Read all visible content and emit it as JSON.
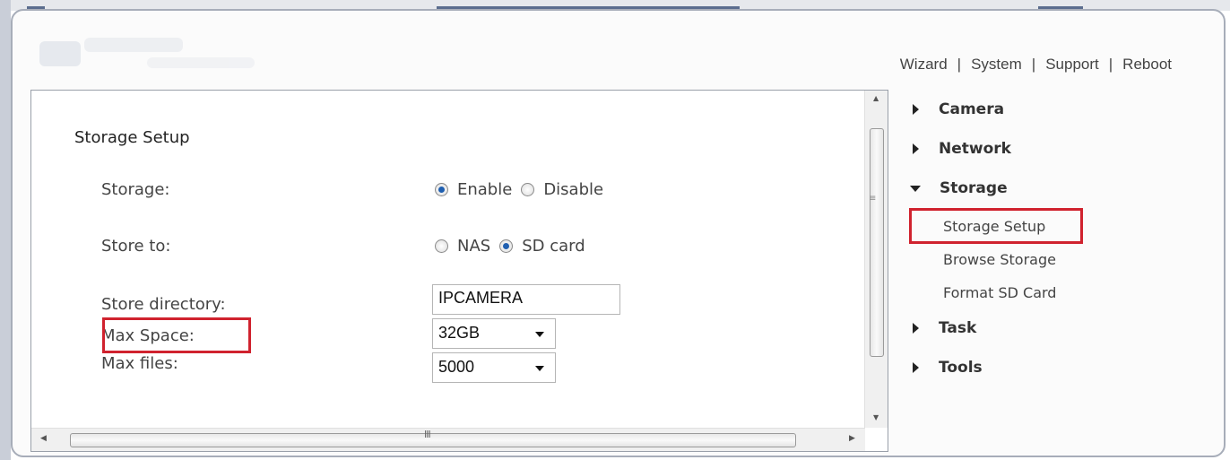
{
  "topnav": {
    "items": [
      "Wizard",
      "System",
      "Support",
      "Reboot"
    ],
    "separator": "|"
  },
  "page": {
    "section_title": "Storage Setup",
    "storage": {
      "label": "Storage:",
      "options": [
        "Enable",
        "Disable"
      ],
      "selected": "Enable"
    },
    "store_to": {
      "label": "Store to:",
      "options": [
        "NAS",
        "SD card"
      ],
      "selected": "SD card"
    },
    "store_directory": {
      "label": "Store directory:",
      "value": "IPCAMERA"
    },
    "max_space": {
      "label": "Max Space:",
      "value": "32GB"
    },
    "max_files": {
      "label": "Max files:",
      "value": "5000"
    }
  },
  "sidebar": {
    "camera": "Camera",
    "network": "Network",
    "storage": "Storage",
    "storage_sub": [
      "Storage Setup",
      "Browse Storage",
      "Format SD Card"
    ],
    "task": "Task",
    "tools": "Tools"
  },
  "colors": {
    "highlight": "#d0222e",
    "radio_selected": "#1f5fb0"
  }
}
